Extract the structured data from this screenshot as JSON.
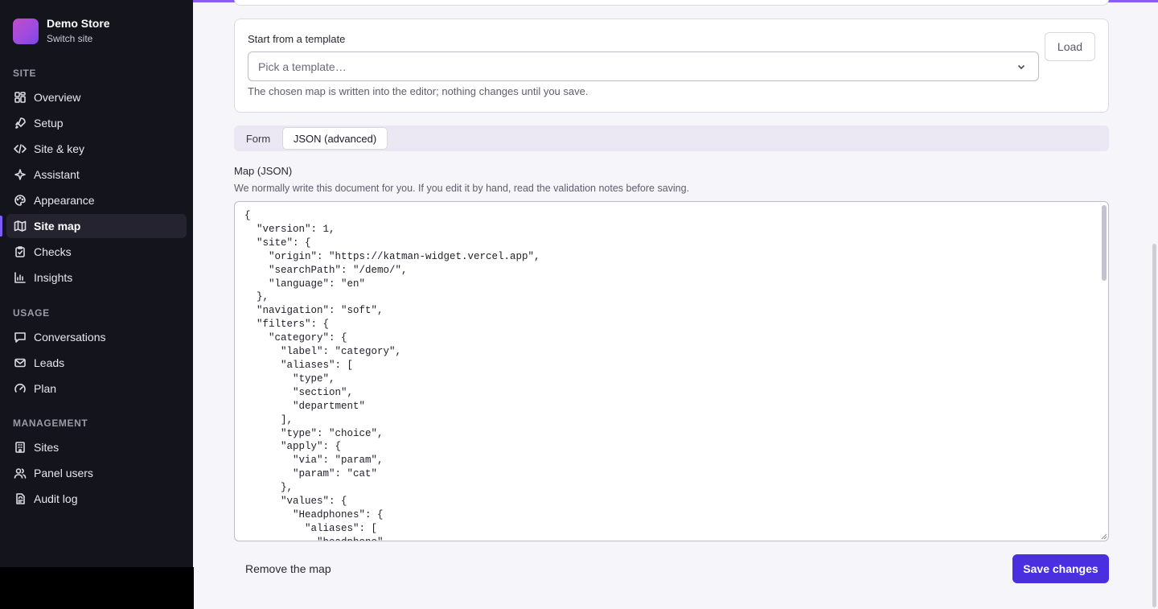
{
  "sidebar": {
    "brand": {
      "name": "Demo Store",
      "switch_label": "Switch site"
    },
    "sections": {
      "site": "SITE",
      "usage": "USAGE",
      "management": "MANAGEMENT"
    },
    "items": [
      {
        "label": "Overview",
        "icon": "grid-icon"
      },
      {
        "label": "Setup",
        "icon": "rocket-icon"
      },
      {
        "label": "Site & key",
        "icon": "code-icon"
      },
      {
        "label": "Assistant",
        "icon": "sparkle-icon"
      },
      {
        "label": "Appearance",
        "icon": "palette-icon"
      },
      {
        "label": "Site map",
        "icon": "map-icon",
        "active": true
      },
      {
        "label": "Checks",
        "icon": "clipboard-check-icon"
      },
      {
        "label": "Insights",
        "icon": "bar-chart-icon"
      },
      {
        "label": "Conversations",
        "icon": "chat-icon"
      },
      {
        "label": "Leads",
        "icon": "mail-icon"
      },
      {
        "label": "Plan",
        "icon": "gauge-icon"
      },
      {
        "label": "Sites",
        "icon": "building-icon"
      },
      {
        "label": "Panel users",
        "icon": "users-icon"
      },
      {
        "label": "Audit log",
        "icon": "log-icon"
      }
    ]
  },
  "template": {
    "label": "Start from a template",
    "placeholder": "Pick a template…",
    "help": "The chosen map is written into the editor; nothing changes until you save.",
    "load_label": "Load"
  },
  "tabs": {
    "form": "Form",
    "json": "JSON (advanced)",
    "active": "json"
  },
  "map": {
    "label": "Map (JSON)",
    "help": "We normally write this document for you. If you edit it by hand, read the validation notes before saving.",
    "json_text": "{\n  \"version\": 1,\n  \"site\": {\n    \"origin\": \"https://katman-widget.vercel.app\",\n    \"searchPath\": \"/demo/\",\n    \"language\": \"en\"\n  },\n  \"navigation\": \"soft\",\n  \"filters\": {\n    \"category\": {\n      \"label\": \"category\",\n      \"aliases\": [\n        \"type\",\n        \"section\",\n        \"department\"\n      ],\n      \"type\": \"choice\",\n      \"apply\": {\n        \"via\": \"param\",\n        \"param\": \"cat\"\n      },\n      \"values\": {\n        \"Headphones\": {\n          \"aliases\": [\n            \"headphone\","
  },
  "actions": {
    "remove_label": "Remove the map",
    "save_label": "Save changes"
  },
  "colors": {
    "accent": "#4a2fe0",
    "sidebar_bg": "#14141c",
    "top_line": "#8b5cf6"
  }
}
